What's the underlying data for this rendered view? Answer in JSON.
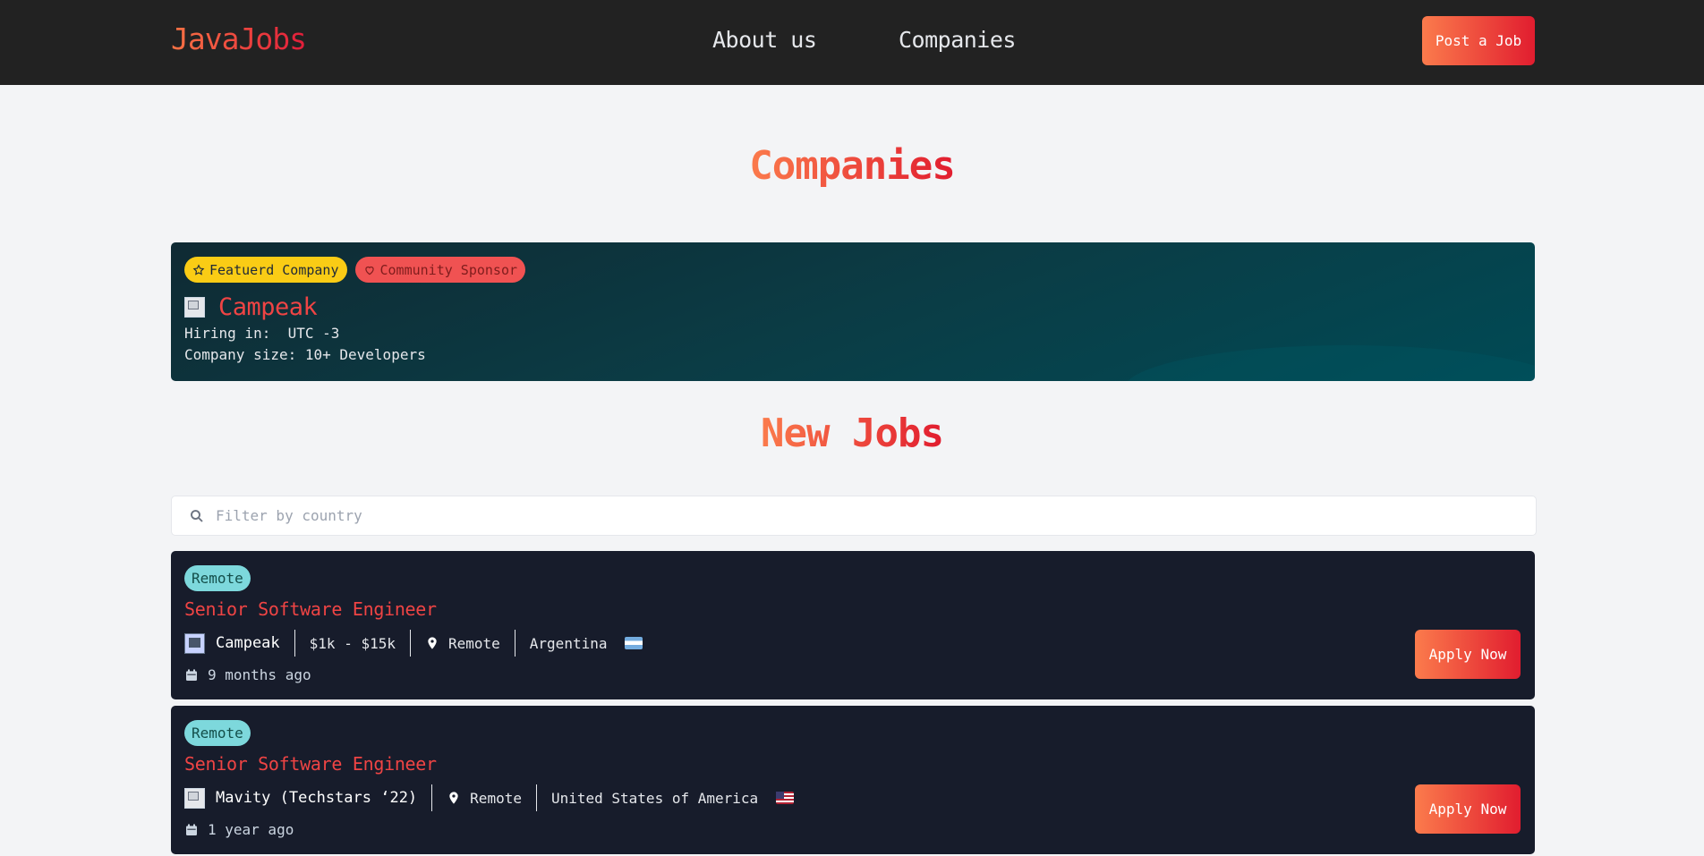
{
  "nav": {
    "logo": "JavaJobs",
    "links": [
      "About us",
      "Companies"
    ],
    "post_button": "Post a Job"
  },
  "companies_section": {
    "title": "Companies",
    "featured_company": {
      "badges": [
        "Featuerd Company",
        "Community Sponsor"
      ],
      "name": "Campeak",
      "hiring_in": "Hiring in:  UTC -3",
      "company_size": "Company size: 10+ Developers"
    }
  },
  "jobs_section": {
    "title": "New Jobs",
    "filter_placeholder": "Filter by country",
    "filter_value": "",
    "jobs": [
      {
        "tag": "Remote",
        "title": "Senior Software Engineer",
        "company": "Campeak",
        "salary": "$1k - $15k",
        "location": "Remote",
        "country": "Argentina",
        "posted": "9 months ago",
        "apply_label": "Apply Now"
      },
      {
        "tag": "Remote",
        "title": "Senior Software Engineer",
        "company": "Mavity (Techstars ‘22)",
        "location": "Remote",
        "country": "United States of America",
        "posted": "1 year ago",
        "apply_label": "Apply Now"
      }
    ]
  },
  "colors": {
    "accent_gradient_start": "#fb7b4c",
    "accent_gradient_end": "#e11d2f",
    "navbar_bg": "#222222",
    "job_card_bg": "#171c2b",
    "remote_badge": "#7dd8dc",
    "featured_badge": "#facc15",
    "sponsor_badge": "#f05252"
  },
  "icons": [
    "search-icon",
    "star-icon",
    "heart-icon",
    "map-pin-icon",
    "calendar-icon",
    "argentina-flag-icon",
    "usa-flag-icon"
  ]
}
